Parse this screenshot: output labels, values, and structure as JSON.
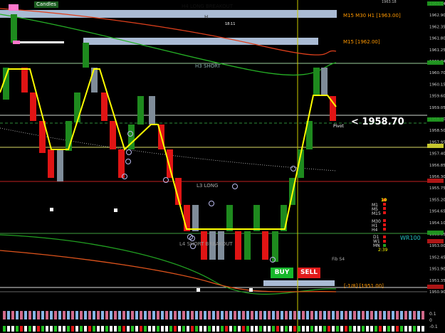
{
  "top_tag": "Candles",
  "levels": {
    "h4_long_breakout": "H4 LONG BREAKOUT",
    "h4_long_small": "H",
    "time_marker": "18:11",
    "m15_m30_h1": "M15 M30 H1 [1963.00]",
    "m15": "M15 [1962.00]",
    "h3_short": "H3 SHORT",
    "l3_long": "L3 LONG",
    "l4_short_breakout": "L4 SHORT BREAKOUT",
    "fib_s4": "Fib S4",
    "neg_1_8": "[-1/8] [1951.00]",
    "wr100": "WR100",
    "pivot": "Pivot",
    "price_readout": "<  1958.70"
  },
  "buttons": {
    "buy": "BUY",
    "sell": "SELL"
  },
  "timeframes": {
    "count": "10",
    "m1": "M1",
    "m5": "M5",
    "m15": "M15",
    "m30": "M30",
    "h1": "H1",
    "h4": "H4",
    "d1": "D1",
    "w1": "W1",
    "mn": "MN",
    "timer": "2:39"
  },
  "top_right_text": "1963.18",
  "axis": [
    "1963.14",
    "1962.90",
    "1962.35",
    "1961.80",
    "1961.25",
    "1961.04",
    "1960.70",
    "1960.15",
    "1959.60",
    "1959.05",
    "1958.70",
    "1958.50",
    "1957.95",
    "1957.40",
    "1956.85",
    "1956.30",
    "1955.75",
    "1955.20",
    "1954.65",
    "1954.10",
    "1953.55",
    "1953.00",
    "1952.45",
    "1951.90",
    "1951.35",
    "1950.90"
  ],
  "sub_axis": [
    "0.1",
    "0",
    "-0.1"
  ],
  "colors": {
    "bull": "#1e8a1e",
    "bear": "#e01414",
    "neutral": "#7f8c99",
    "zigzag": "#ffff00",
    "level_band": "#aabbd4"
  }
}
